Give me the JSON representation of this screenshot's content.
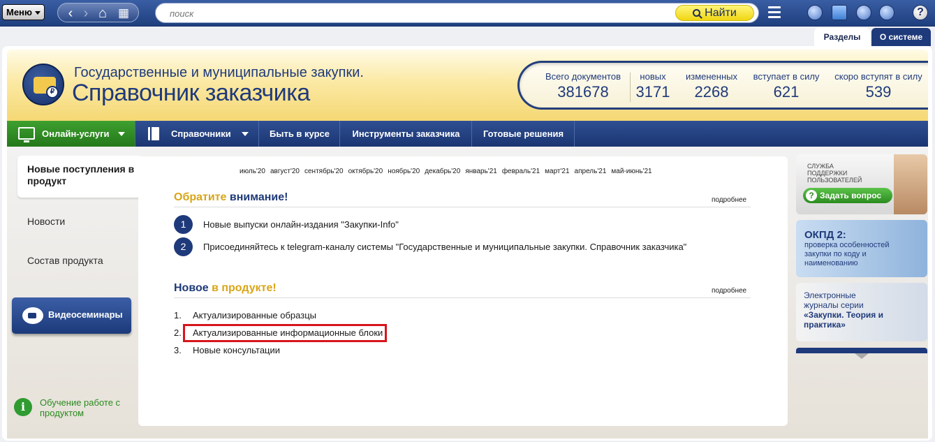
{
  "topbar": {
    "menu_label": "Меню",
    "search_placeholder": "поиск",
    "search_button": "Найти"
  },
  "tabs": [
    {
      "label": "Разделы",
      "active": true
    },
    {
      "label": "О системе",
      "active": false
    }
  ],
  "banner": {
    "subtitle": "Государственные и муниципальные закупки.",
    "title": "Справочник заказчика"
  },
  "stats": [
    {
      "label": "Всего документов",
      "value": "381678"
    },
    {
      "label": "новых",
      "value": "3171"
    },
    {
      "label": "измененных",
      "value": "2268"
    },
    {
      "label": "вступает в силу",
      "value": "621"
    },
    {
      "label": "скоро вступят в силу",
      "value": "539"
    }
  ],
  "nav": {
    "online": "Онлайн-услуги",
    "directories": "Справочники",
    "news": "Быть в курсе",
    "tools": "Инструменты заказчика",
    "solutions": "Готовые решения"
  },
  "sidebar": {
    "active": "Новые поступления в продукт",
    "items": [
      "Новости",
      "Состав продукта"
    ],
    "video": "Видеосеминары",
    "learn": "Обучение работе с продуктом"
  },
  "months": [
    "июль'20",
    "август'20",
    "сентябрь'20",
    "октябрь'20",
    "ноябрь'20",
    "декабрь'20",
    "январь'21",
    "февраль'21",
    "март'21",
    "апрель'21",
    "май-июнь'21"
  ],
  "attention": {
    "title_a": "Обратите",
    "title_b": "внимание!",
    "more": "подробнее",
    "items": [
      {
        "num": "1",
        "text": "Новые выпуски онлайн-издания \"Закупки-Info\""
      },
      {
        "num": "2",
        "text": "Присоединяйтесь к telegram-каналу системы \"Государственные и муниципальные закупки. Справочник заказчика\""
      }
    ]
  },
  "new_in_product": {
    "title_a": "Новое",
    "title_b": "в продукте!",
    "more": "подробнее",
    "items": [
      {
        "num": "1.",
        "text": "Актуализированные образцы"
      },
      {
        "num": "2.",
        "text": "Актуализированные информационные блоки"
      },
      {
        "num": "3.",
        "text": "Новые консультации"
      }
    ]
  },
  "right": {
    "support_small": "СЛУЖБА ПОДДЕРЖКИ ПОЛЬЗОВАТЕЛЕЙ",
    "ask": "Задать вопрос",
    "okpd_title": "ОКПД 2:",
    "okpd_sub": "проверка особенностей закупки по коду и наименованию",
    "journal_a": "Электронные журналы серии",
    "journal_b": "«Закупки. Теория и практика»"
  },
  "colors": {
    "navy": "#1f3a7b",
    "gold": "#d9a516",
    "green": "#2f9b31",
    "highlight": "#d8141c"
  }
}
